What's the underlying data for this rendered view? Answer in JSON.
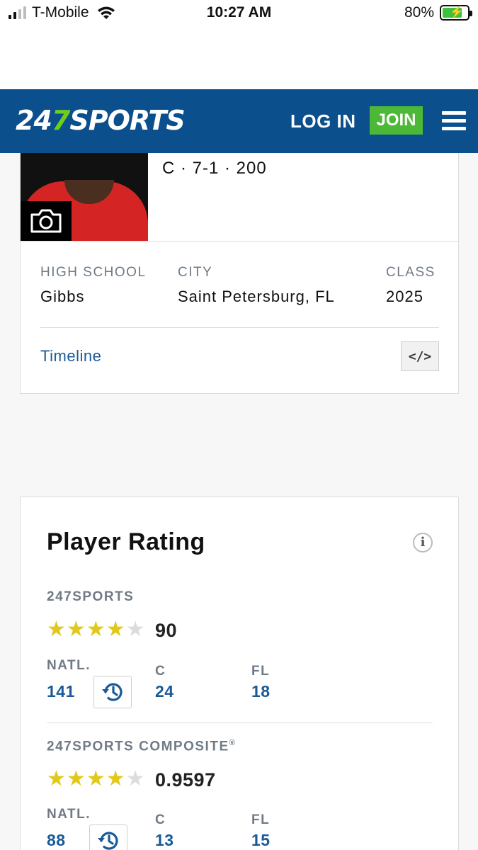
{
  "status_bar": {
    "carrier": "T-Mobile",
    "time": "10:27 AM",
    "battery": "80%",
    "battery_level": 0.8
  },
  "header": {
    "logo_number": "24",
    "logo_seven": "7",
    "logo_word": "SPORTS",
    "login_label": "LOG IN",
    "join_label": "JOIN",
    "menu_icon": "hamburger-icon"
  },
  "profile": {
    "stats_line": "C · 7-1 · 200",
    "camera_icon": "camera-icon",
    "fields": {
      "high_school_label": "HIGH SCHOOL",
      "high_school_value": "Gibbs",
      "city_label": "CITY",
      "city_value": "Saint Petersburg, FL",
      "class_label": "CLASS",
      "class_value": "2025"
    },
    "timeline_label": "Timeline",
    "embed_label": "</>"
  },
  "rating": {
    "title": "Player Rating",
    "info_label": "i",
    "sections": [
      {
        "label": "247SPORTS",
        "stars": 4,
        "max_stars": 5,
        "score": "90",
        "natl_label": "NATL.",
        "natl_value": "141",
        "pos_label": "C",
        "pos_value": "24",
        "state_label": "FL",
        "state_value": "18"
      },
      {
        "label": "247SPORTS COMPOSITE",
        "label_mark": "®",
        "stars": 4,
        "max_stars": 5,
        "score": "0.9597",
        "natl_label": "NATL.",
        "natl_value": "88",
        "pos_label": "C",
        "pos_value": "13",
        "state_label": "FL",
        "state_value": "15"
      }
    ]
  },
  "colors": {
    "header_bg": "#0b4f8c",
    "join_bg": "#4db838",
    "logo_accent": "#6fce1c",
    "link": "#1a5a96",
    "star_on": "#e2c81a",
    "star_off": "#dcdcdc"
  }
}
